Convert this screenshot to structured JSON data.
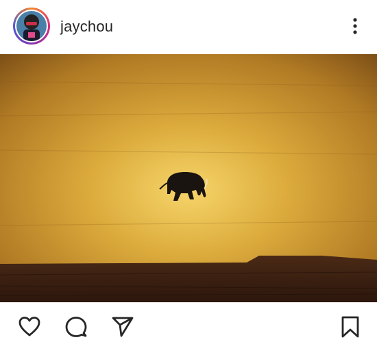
{
  "post": {
    "username": "jaychou",
    "avatar_icon": "profile-avatar",
    "more_icon": "more-vertical-icon"
  },
  "image": {
    "subject": "elephant-silhouette-painting",
    "sky_color": "#d9a435",
    "ground_color": "#3b1f12"
  },
  "actions": {
    "like_icon": "heart-icon",
    "comment_icon": "comment-icon",
    "share_icon": "send-icon",
    "save_icon": "bookmark-icon"
  }
}
